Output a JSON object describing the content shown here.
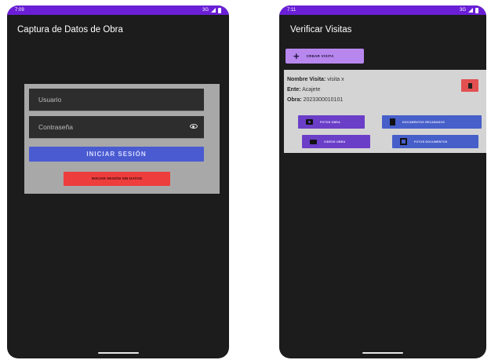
{
  "screen1": {
    "status": {
      "time": "7:09",
      "network": "3G"
    },
    "title": "Captura de Datos de Obra",
    "login": {
      "username_placeholder": "Usuario",
      "password_placeholder": "Contraseña",
      "login_button": "INICIAR SESIÓN",
      "login_nodata_button": "INICIAR SESIÓN SIN DATOS"
    }
  },
  "screen2": {
    "status": {
      "time": "7:11",
      "network": "3G"
    },
    "title": "Verificar Visitas",
    "create_button": "CREAR VISITA",
    "visit": {
      "name_label": "Nombre Visita:",
      "name_value": "visita x",
      "ente_label": "Ente:",
      "ente_value": "Acajete",
      "obra_label": "Obra:",
      "obra_value": "2023300010101"
    },
    "actions": {
      "fotos_obra": "FOTOS OBRA",
      "documentos_recabados": "DOCUMENTOS RECABADOS",
      "videos_obra": "VIDEOS OBRA",
      "fotos_documentos": "FOTOS DOCUMENTOS"
    }
  },
  "colors": {
    "statusbar": "#6a1fd6",
    "login_button": "#4a5bd1",
    "danger": "#ee3d3d",
    "create_button": "#b787ee",
    "action_purple": "#6b3ec8",
    "action_blue": "#465fc9"
  }
}
